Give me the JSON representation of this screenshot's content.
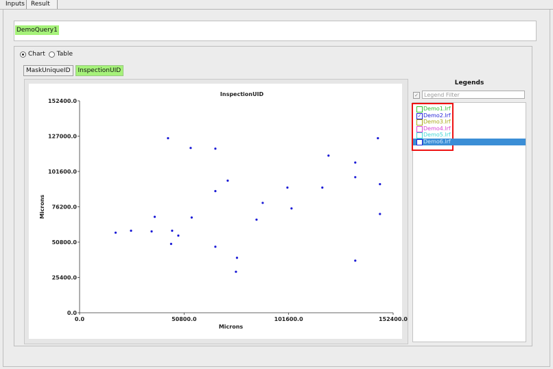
{
  "tabs": [
    {
      "label": "Inputs"
    },
    {
      "label": "Result"
    }
  ],
  "query": {
    "chip": "DemoQuery1"
  },
  "view_mode": {
    "chart_label": "Chart",
    "table_label": "Table",
    "selected": "Chart"
  },
  "buttons": {
    "mask_unique": "MaskUniqueID",
    "inspection": "InspectionUID"
  },
  "legend": {
    "title": "Legends",
    "filter_placeholder": "Legend Filter",
    "items": [
      {
        "label": "Demo1.lrf",
        "checked": false,
        "color": "#2ec22e"
      },
      {
        "label": "Demo2.lrf",
        "checked": true,
        "color": "#1f1fd6"
      },
      {
        "label": "Demo3.lrf",
        "checked": false,
        "color": "#a8a818"
      },
      {
        "label": "Demo4.lrf",
        "checked": false,
        "color": "#d640d6"
      },
      {
        "label": "Demo5.lrf",
        "checked": false,
        "color": "#3fd6d6"
      },
      {
        "label": "Demo6.lrf",
        "checked": false,
        "color": "#1f1fd6"
      }
    ]
  },
  "chart_data": {
    "type": "scatter",
    "title": "InspectionUID",
    "xlabel": "Microns",
    "ylabel": "Microns",
    "xlim": [
      0,
      152400
    ],
    "ylim": [
      0,
      152400
    ],
    "xticks": [
      "0.0",
      "50800.0",
      "101600.0",
      "152400.0"
    ],
    "yticks": [
      "0.0",
      "25400.0",
      "50800.0",
      "76200.0",
      "101600.0",
      "127000.0",
      "152400.0"
    ],
    "marker_color": "#1a1ad6",
    "series": [
      {
        "points": [
          [
            17500,
            57600
          ],
          [
            25000,
            59000
          ],
          [
            35000,
            58500
          ],
          [
            36500,
            69000
          ],
          [
            43000,
            125500
          ],
          [
            45000,
            59000
          ],
          [
            44500,
            49500
          ],
          [
            48000,
            55500
          ],
          [
            54000,
            118500
          ],
          [
            54500,
            68500
          ],
          [
            66000,
            118000
          ],
          [
            66000,
            87500
          ],
          [
            66000,
            47500
          ],
          [
            72000,
            95000
          ],
          [
            76500,
            39500
          ],
          [
            76000,
            29500
          ],
          [
            86000,
            67000
          ],
          [
            89000,
            79000
          ],
          [
            101000,
            90000
          ],
          [
            103000,
            75000
          ],
          [
            118000,
            90000
          ],
          [
            121000,
            113000
          ],
          [
            134000,
            108000
          ],
          [
            134000,
            97500
          ],
          [
            134000,
            37500
          ],
          [
            145000,
            125500
          ],
          [
            146000,
            92500
          ],
          [
            146000,
            71000
          ]
        ]
      }
    ]
  }
}
